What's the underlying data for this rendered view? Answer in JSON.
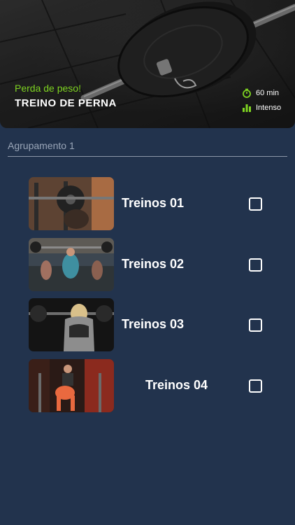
{
  "hero": {
    "subtitle": "Perda de peso!",
    "title": "TREINO DE PERNA",
    "duration": "60 min",
    "intensity": "Intenso",
    "accent_color": "#7ed321",
    "icons": [
      "stopwatch-icon",
      "bar-chart-icon"
    ]
  },
  "group": {
    "label": "Agrupamento 1"
  },
  "workouts": [
    {
      "label": "Treinos 01",
      "checked": false
    },
    {
      "label": "Treinos 02",
      "checked": false
    },
    {
      "label": "Treinos 03",
      "checked": false
    },
    {
      "label": "Treinos 04",
      "checked": false
    }
  ],
  "colors": {
    "background": "#22334d",
    "text": "#ffffff",
    "muted": "#9aa6b8"
  }
}
